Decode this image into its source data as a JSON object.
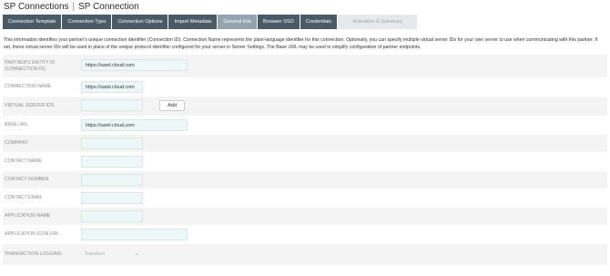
{
  "header": {
    "section": "SP Connections",
    "page": "SP Connection"
  },
  "tabs": [
    {
      "label": "Connection Template"
    },
    {
      "label": "Connection Type"
    },
    {
      "label": "Connection Options"
    },
    {
      "label": "Import Metadata"
    },
    {
      "label": "General Info"
    },
    {
      "label": "Browser SSO"
    },
    {
      "label": "Credentials"
    },
    {
      "label": "Activation & Summary"
    }
  ],
  "intro": "This information identifies your partner's unique connection identifier (Connection ID). Connection Name represents the plain-language identifier for this connection. Optionally, you can specify multiple virtual server IDs for your own server to use when communicating with this partner. If set, these virtual server IDs will be used in place of the unique protocol identifier configured for your server in Server Settings. The Base URL may be used to simplify configuration of partner endpoints.",
  "form": {
    "entity_id": {
      "label": "Partner's Entity ID (Connection ID)",
      "value": "https://saml.cloud.com"
    },
    "connection_name": {
      "label": "Connection Name",
      "value": "https://saml.cloud.com"
    },
    "virtual_server_ids": {
      "label": "Virtual Server IDs",
      "value": "",
      "add_label": "Add"
    },
    "base_url": {
      "label": "Base URL",
      "value": "https://saml.cloud.com"
    },
    "company": {
      "label": "Company",
      "value": ""
    },
    "contact_name": {
      "label": "Contact Name",
      "value": ""
    },
    "contact_number": {
      "label": "Contact Number",
      "value": ""
    },
    "contact_email": {
      "label": "Contact Email",
      "value": ""
    },
    "application_name": {
      "label": "Application Name",
      "value": ""
    },
    "application_icon_url": {
      "label": "Application Icon URL",
      "value": ""
    },
    "transaction_logging": {
      "label": "Transaction Logging",
      "value": "Standard"
    }
  }
}
